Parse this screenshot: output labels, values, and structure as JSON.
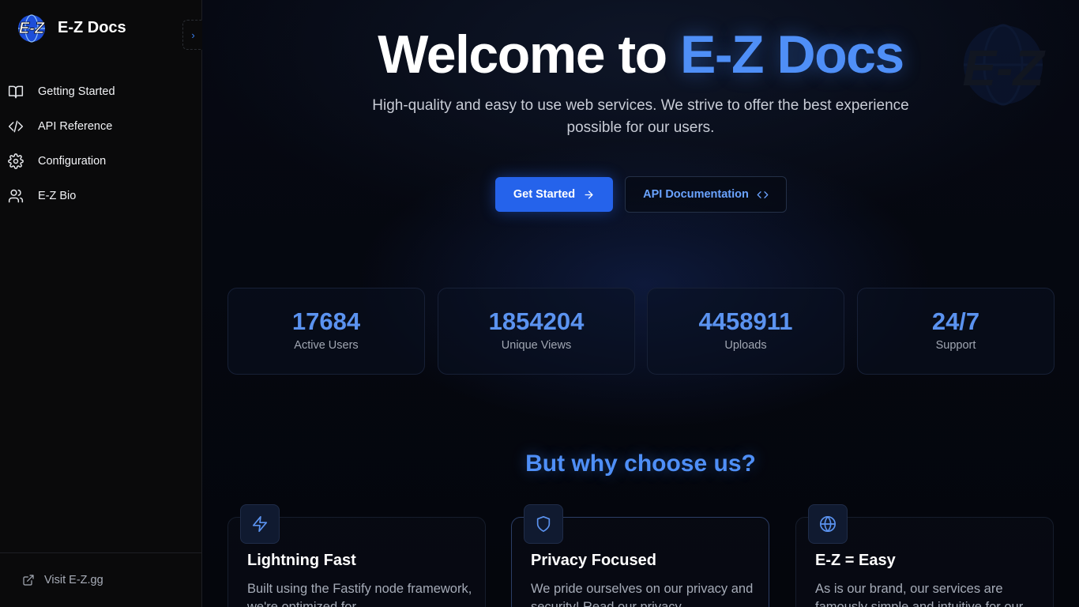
{
  "sidebar": {
    "brand": {
      "logo_text": "E-Z",
      "name": "E-Z Docs"
    },
    "collapse_icon": "chevron-right-icon",
    "items": [
      {
        "label": "Getting Started",
        "icon": "book-open-icon"
      },
      {
        "label": "API Reference",
        "icon": "code-icon"
      },
      {
        "label": "Configuration",
        "icon": "gear-icon"
      },
      {
        "label": "E-Z Bio",
        "icon": "users-icon"
      }
    ],
    "footer": {
      "label": "Visit E-Z.gg",
      "icon": "external-link-icon"
    }
  },
  "hero": {
    "title_prefix": "Welcome to ",
    "title_accent": "E-Z Docs",
    "subtitle": "High-quality and easy to use web services. We strive to offer the best experience possible for our users.",
    "primary_button": {
      "label": "Get Started",
      "icon": "arrow-right-icon"
    },
    "secondary_button": {
      "label": "API Documentation",
      "icon": "code-icon"
    },
    "watermark_text": "E-Z"
  },
  "stats": [
    {
      "value": "17684",
      "label": "Active Users"
    },
    {
      "value": "1854204",
      "label": "Unique Views"
    },
    {
      "value": "4458911",
      "label": "Uploads"
    },
    {
      "value": "24/7",
      "label": "Support"
    }
  ],
  "features": {
    "heading": "But why choose us?",
    "items": [
      {
        "title": "Lightning Fast",
        "description": "Built using the Fastify node framework, we're optimized for",
        "icon": "lightning-icon"
      },
      {
        "title": "Privacy Focused",
        "description": "We pride ourselves on our privacy and security! Read our privacy",
        "icon": "shield-icon"
      },
      {
        "title": "E-Z = Easy",
        "description": "As is our brand, our services are famously simple and intuitive for our",
        "icon": "globe-icon"
      }
    ]
  },
  "colors": {
    "accent": "#4f8ff7",
    "primary_button": "#2563eb",
    "sidebar_bg": "#0a0a0b",
    "main_bg": "#05070d"
  }
}
